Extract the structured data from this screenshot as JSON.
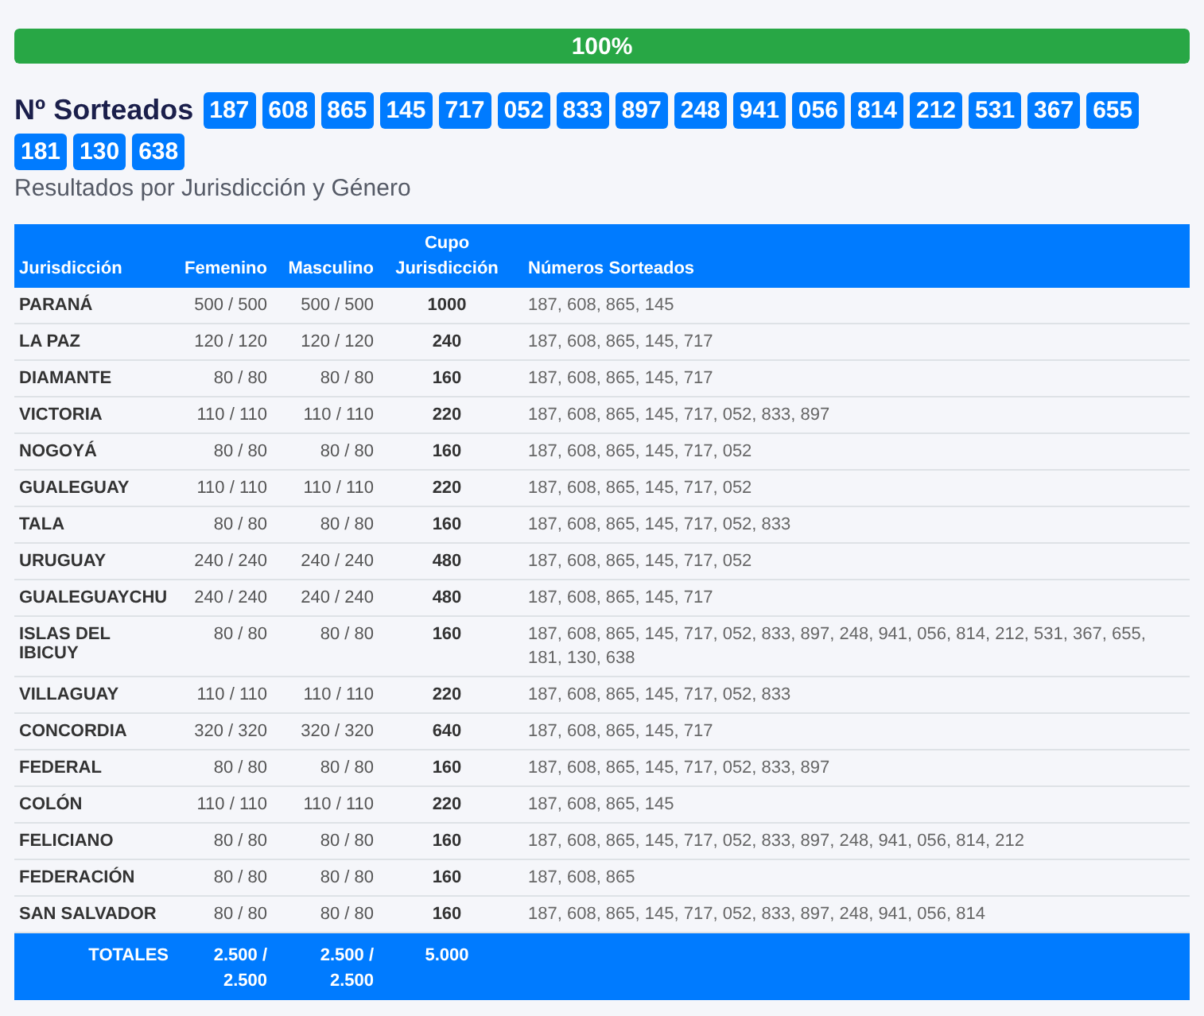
{
  "progress": {
    "label": "100%",
    "level": 1
  },
  "heading": "Nº Sorteados",
  "drawn_numbers": [
    "187",
    "608",
    "865",
    "145",
    "717",
    "052",
    "833",
    "897",
    "248",
    "941",
    "056",
    "814",
    "212",
    "531",
    "367",
    "655",
    "181",
    "130",
    "638"
  ],
  "subtitle": "Resultados por Jurisdicción y Género",
  "table": {
    "columns": [
      "Jurisdicción",
      "Femenino",
      "Masculino",
      "Cupo Jurisdicción",
      "Números Sorteados"
    ],
    "rows": [
      {
        "jurisdiccion": "PARANÁ",
        "femenino": "500 / 500",
        "masculino": "500 / 500",
        "cupo": "1000",
        "numeros": "187, 608, 865, 145"
      },
      {
        "jurisdiccion": "LA PAZ",
        "femenino": "120 / 120",
        "masculino": "120 / 120",
        "cupo": "240",
        "numeros": "187, 608, 865, 145, 717"
      },
      {
        "jurisdiccion": "DIAMANTE",
        "femenino": "80 / 80",
        "masculino": "80 / 80",
        "cupo": "160",
        "numeros": "187, 608, 865, 145, 717"
      },
      {
        "jurisdiccion": "VICTORIA",
        "femenino": "110 / 110",
        "masculino": "110 / 110",
        "cupo": "220",
        "numeros": "187, 608, 865, 145, 717, 052, 833, 897"
      },
      {
        "jurisdiccion": "NOGOYÁ",
        "femenino": "80 / 80",
        "masculino": "80 / 80",
        "cupo": "160",
        "numeros": "187, 608, 865, 145, 717, 052"
      },
      {
        "jurisdiccion": "GUALEGUAY",
        "femenino": "110 / 110",
        "masculino": "110 / 110",
        "cupo": "220",
        "numeros": "187, 608, 865, 145, 717, 052"
      },
      {
        "jurisdiccion": "TALA",
        "femenino": "80 / 80",
        "masculino": "80 / 80",
        "cupo": "160",
        "numeros": "187, 608, 865, 145, 717, 052, 833"
      },
      {
        "jurisdiccion": "URUGUAY",
        "femenino": "240 / 240",
        "masculino": "240 / 240",
        "cupo": "480",
        "numeros": "187, 608, 865, 145, 717, 052"
      },
      {
        "jurisdiccion": "GUALEGUAYCHU",
        "femenino": "240 / 240",
        "masculino": "240 / 240",
        "cupo": "480",
        "numeros": "187, 608, 865, 145, 717"
      },
      {
        "jurisdiccion": "ISLAS DEL IBICUY",
        "femenino": "80 / 80",
        "masculino": "80 / 80",
        "cupo": "160",
        "numeros": "187, 608, 865, 145, 717, 052, 833, 897, 248, 941, 056, 814, 212, 531, 367, 655, 181, 130, 638"
      },
      {
        "jurisdiccion": "VILLAGUAY",
        "femenino": "110 / 110",
        "masculino": "110 / 110",
        "cupo": "220",
        "numeros": "187, 608, 865, 145, 717, 052, 833"
      },
      {
        "jurisdiccion": "CONCORDIA",
        "femenino": "320 / 320",
        "masculino": "320 / 320",
        "cupo": "640",
        "numeros": "187, 608, 865, 145, 717"
      },
      {
        "jurisdiccion": "FEDERAL",
        "femenino": "80 / 80",
        "masculino": "80 / 80",
        "cupo": "160",
        "numeros": "187, 608, 865, 145, 717, 052, 833, 897"
      },
      {
        "jurisdiccion": "COLÓN",
        "femenino": "110 / 110",
        "masculino": "110 / 110",
        "cupo": "220",
        "numeros": "187, 608, 865, 145"
      },
      {
        "jurisdiccion": "FELICIANO",
        "femenino": "80 / 80",
        "masculino": "80 / 80",
        "cupo": "160",
        "numeros": "187, 608, 865, 145, 717, 052, 833, 897, 248, 941, 056, 814, 212"
      },
      {
        "jurisdiccion": "FEDERACIÓN",
        "femenino": "80 / 80",
        "masculino": "80 / 80",
        "cupo": "160",
        "numeros": "187, 608, 865"
      },
      {
        "jurisdiccion": "SAN SALVADOR",
        "femenino": "80 / 80",
        "masculino": "80 / 80",
        "cupo": "160",
        "numeros": "187, 608, 865, 145, 717, 052, 833, 897, 248, 941, 056, 814"
      }
    ],
    "totals": {
      "label": "TOTALES",
      "femenino": "2.500 / 2.500",
      "masculino": "2.500 / 2.500",
      "cupo": "5.000"
    }
  }
}
